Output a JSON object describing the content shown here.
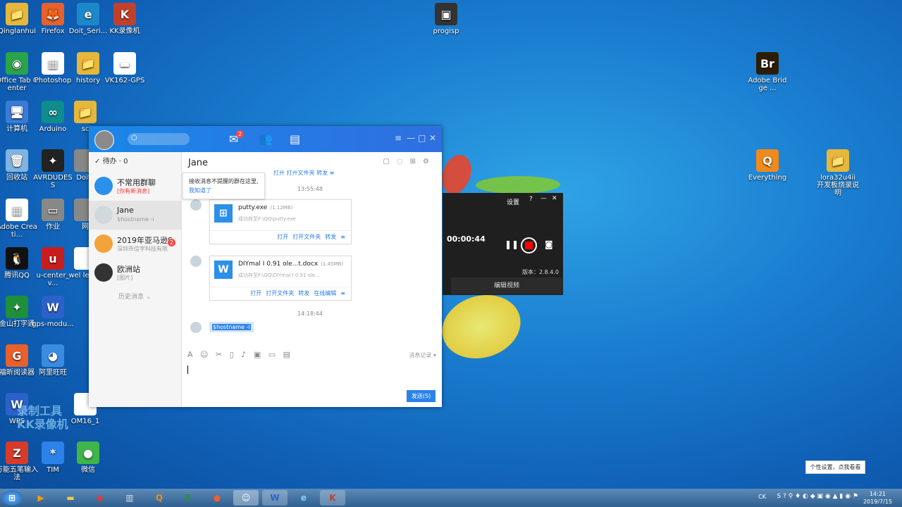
{
  "desktop_icons": [
    {
      "label": "Qinglanhui",
      "color": "#e6b73b",
      "glyph": "📁"
    },
    {
      "label": "Firefox",
      "color": "#e8602c",
      "glyph": "🦊"
    },
    {
      "label": "Doit_Seri...",
      "color": "#1d88c9",
      "glyph": "e"
    },
    {
      "label": "KK录像机",
      "color": "#c2402a",
      "glyph": "K"
    },
    {
      "label": "progisp",
      "color": "#333",
      "glyph": "▣"
    },
    {
      "label": "Office Tab Center",
      "color": "#2aa34a",
      "glyph": "◉"
    },
    {
      "label": "Photoshop",
      "color": "#ffffff",
      "glyph": "▦"
    },
    {
      "label": "history",
      "color": "#e6b73b",
      "glyph": "📁"
    },
    {
      "label": "VK162-GPS",
      "color": "#ffffff",
      "glyph": "▬"
    },
    {
      "label": "Adobe Bridge ...",
      "color": "#2b1d05",
      "glyph": "Br"
    },
    {
      "label": "计算机",
      "color": "#3a7bd5",
      "glyph": "🖥"
    },
    {
      "label": "Arduino",
      "color": "#0f8c8c",
      "glyph": "∞"
    },
    {
      "label": "sc",
      "color": "#e6b73b",
      "glyph": "📁"
    },
    {
      "label": "回收站",
      "color": "#7fb4e0",
      "glyph": "🗑"
    },
    {
      "label": "AVRDUDESS",
      "color": "#222",
      "glyph": "✦"
    },
    {
      "label": "Doit_",
      "color": "#888",
      "glyph": ""
    },
    {
      "label": "Everything",
      "color": "#f08a1c",
      "glyph": "Q"
    },
    {
      "label": "lora32u4ii开发板烧录说明",
      "color": "#e6b73b",
      "glyph": "📁"
    },
    {
      "label": "Adobe Creati...",
      "color": "#ffffff",
      "glyph": "▦"
    },
    {
      "label": "作业",
      "color": "#888",
      "glyph": "▭"
    },
    {
      "label": "网",
      "color": "#888",
      "glyph": ""
    },
    {
      "label": "腾讯QQ",
      "color": "#111",
      "glyph": "🐧"
    },
    {
      "label": "u-center_v...",
      "color": "#c91d1d",
      "glyph": "u"
    },
    {
      "label": "wel letter",
      "color": "#fff",
      "glyph": ""
    },
    {
      "label": "金山打字通",
      "color": "#1e8f3a",
      "glyph": "✦"
    },
    {
      "label": "gps-modu...",
      "color": "#2b62c9",
      "glyph": "W"
    },
    {
      "label": "福昕阅读器",
      "color": "#e8602c",
      "glyph": "G"
    },
    {
      "label": "阿里旺旺",
      "color": "#3a8ce0",
      "glyph": "◕"
    },
    {
      "label": "WPS",
      "color": "#2b62c9",
      "glyph": "W"
    },
    {
      "label": "OM16_1",
      "color": "#fff",
      "glyph": ""
    },
    {
      "label": "万能五笔输入法",
      "color": "#d93b2b",
      "glyph": "Z"
    },
    {
      "label": "TIM",
      "color": "#2b82e8",
      "glyph": "*"
    },
    {
      "label": "微信",
      "color": "#3fb54a",
      "glyph": "●"
    }
  ],
  "watermark": {
    "line1": "录制工具",
    "line2": "KK录像机"
  },
  "qq": {
    "badge_count": "2",
    "todo": "待办 · 0",
    "conversations": [
      {
        "name": "不常用群聊",
        "sub": "[你有新消息]",
        "sub_red": true,
        "color": "#2b90e9"
      },
      {
        "name": "Jane",
        "sub": "$hostname -i",
        "sub_red": false,
        "color": "#d1d9df"
      },
      {
        "name": "2019年亚马逊S",
        "sub": "深圳市信宇科技有限",
        "sub_red": false,
        "color": "#f2a33a",
        "badge": "2"
      },
      {
        "name": "欧洲站",
        "sub": "[图片]",
        "sub_red": false,
        "color": "#333"
      }
    ],
    "history_label": "历史消息",
    "chat_title": "Jane",
    "tip": {
      "text": "接收消息不提醒的群在这里,",
      "link": "我知道了"
    },
    "messages": {
      "ts1": "13:55:48",
      "file1": {
        "name": "putty.exe",
        "size": "(1.12MB)",
        "status": "成功存至F:\\QQ\\putty.exe",
        "icon": "⊞",
        "actions": [
          "打开",
          "打开文件夹",
          "转发",
          "≡"
        ]
      },
      "file2": {
        "name": "DIYmal I 0.91 ole...t.docx",
        "size": "(1.45MB)",
        "status": "成功存至F:\\QQ\\DIYmal I 0.91 ole...",
        "icon": "W",
        "actions": [
          "打开",
          "打开文件夹",
          "转发",
          "在线编辑",
          "≡"
        ]
      },
      "ts2": "14:18:44",
      "text": "$hostname -i",
      "top_actions": [
        "打开",
        "打开文件夹",
        "转发"
      ]
    },
    "toolbar_history": "消息记录 ▾",
    "send": "发送(S)"
  },
  "recorder": {
    "settings": "设置",
    "time": "00:00:44",
    "version": "版本：2.8.4.0",
    "edit": "编辑视频"
  },
  "tray": {
    "time": "14:21",
    "date": "2019/7/15",
    "lang": "CK",
    "balloon": "个性设置，点我看看"
  }
}
